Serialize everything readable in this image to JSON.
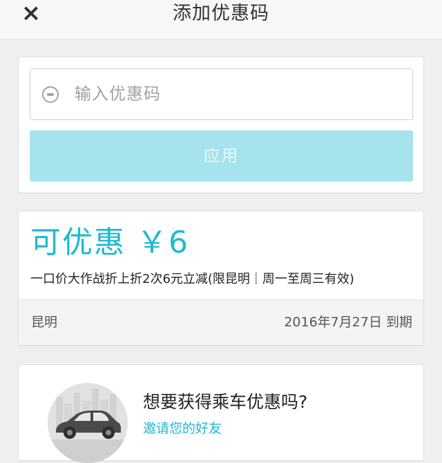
{
  "header": {
    "close_icon": "×",
    "title": "添加优惠码"
  },
  "promo_input": {
    "placeholder": "输入优惠码",
    "value": "",
    "icon": "promo-tag-icon"
  },
  "apply_button": {
    "label": "应用",
    "disabled": true,
    "color": "#a6e3ec"
  },
  "coupon": {
    "amount_text": "可优惠 ￥6",
    "description": "一口价大作战折上折2次6元立减(限昆明｜周一至周三有效)",
    "city": "昆明",
    "expiry": "2016年7月27日 到期",
    "accent_color": "#1fb9cf"
  },
  "invite": {
    "title": "想要获得乘车优惠吗?",
    "link": "邀请您的好友",
    "illustration": "car-illustration"
  }
}
